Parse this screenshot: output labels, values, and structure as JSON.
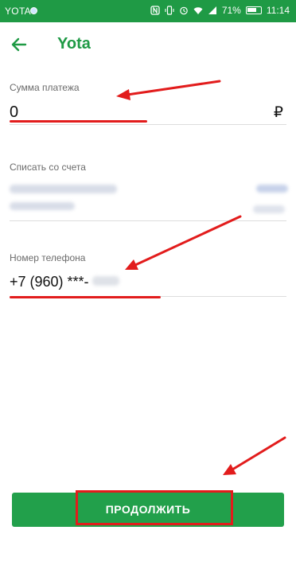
{
  "statusbar": {
    "carrier": "YOTA",
    "battery": "71%",
    "time": "11:14"
  },
  "appbar": {
    "back_icon": "arrow-left-icon",
    "title": "Yota"
  },
  "payment": {
    "amount_label": "Сумма платежа",
    "amount_value": "0",
    "currency_symbol": "₽"
  },
  "account": {
    "label": "Списать со счета"
  },
  "phone": {
    "label": "Номер телефона",
    "value": "+7 (960) ***-"
  },
  "actions": {
    "continue_label": "ПРОДОЛЖИТЬ"
  },
  "colors": {
    "brand_green": "#1f9a45",
    "button_green": "#22a04b",
    "annotation_red": "#e21c1c"
  }
}
